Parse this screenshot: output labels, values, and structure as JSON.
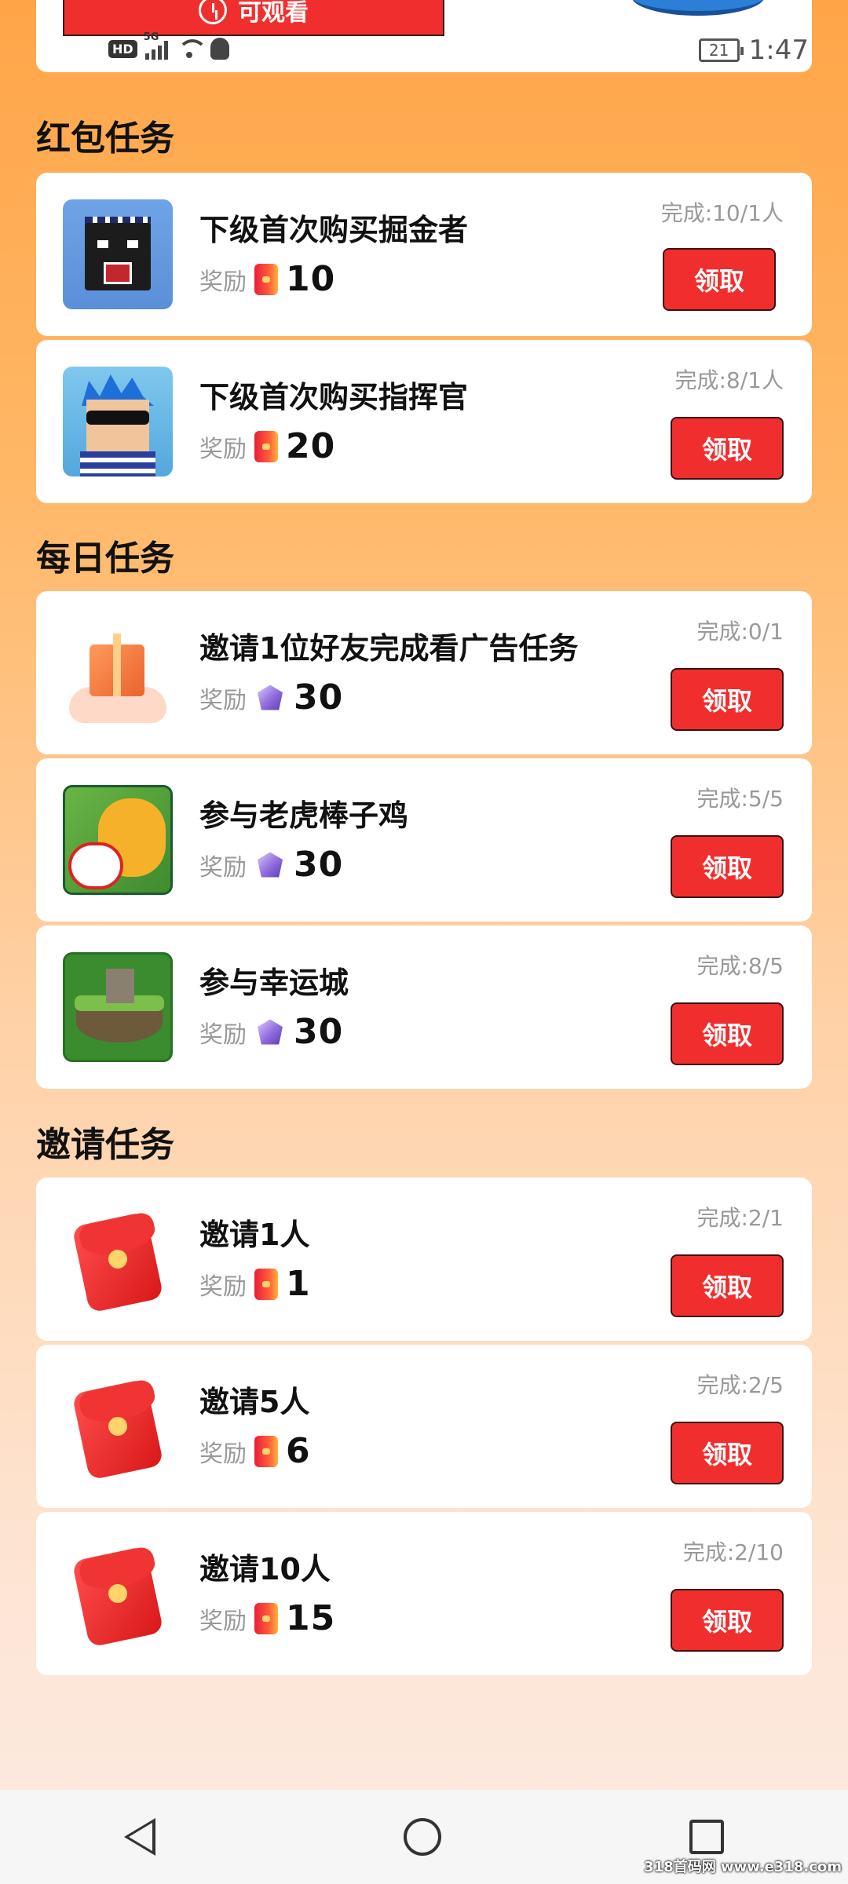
{
  "top": {
    "watch_label": "可观看",
    "time": "1:47",
    "battery": "21",
    "network": "5G",
    "hd_label": "HD"
  },
  "sections": {
    "redpack_title": "红包任务",
    "daily_title": "每日任务",
    "invite_title": "邀请任务"
  },
  "reward_label": "奖励",
  "claim_label": "领取",
  "tasks": [
    {
      "name": "下级首次购买掘金者",
      "reward": "10",
      "status": "完成:10/1人",
      "reward_icon": "redpack-icon",
      "task_icon": "miner-icon"
    },
    {
      "name": "下级首次购买指挥官",
      "reward": "20",
      "status": "完成:8/1人",
      "reward_icon": "redpack-icon",
      "task_icon": "commander-icon"
    },
    {
      "name": "邀请1位好友完成看广告任务",
      "reward": "30",
      "status": "完成:0/1",
      "reward_icon": "gem-icon",
      "task_icon": "gift-icon"
    },
    {
      "name": "参与老虎棒子鸡",
      "reward": "30",
      "status": "完成:5/5",
      "reward_icon": "gem-icon",
      "task_icon": "tiger-icon"
    },
    {
      "name": "参与幸运城",
      "reward": "30",
      "status": "完成:8/5",
      "reward_icon": "gem-icon",
      "task_icon": "castle-icon"
    },
    {
      "name": "邀请1人",
      "reward": "1",
      "status": "完成:2/1",
      "reward_icon": "redpack-icon",
      "task_icon": "red-envelope-icon"
    },
    {
      "name": "邀请5人",
      "reward": "6",
      "status": "完成:2/5",
      "reward_icon": "redpack-icon",
      "task_icon": "red-envelope-icon"
    },
    {
      "name": "邀请10人",
      "reward": "15",
      "status": "完成:2/10",
      "reward_icon": "redpack-icon",
      "task_icon": "red-envelope-icon"
    }
  ],
  "watermark": "318首码网 www.e318.com",
  "colors": {
    "accent": "#f12e2e",
    "bg_top": "#ffa548",
    "bg_bottom": "#fbe9e0"
  }
}
